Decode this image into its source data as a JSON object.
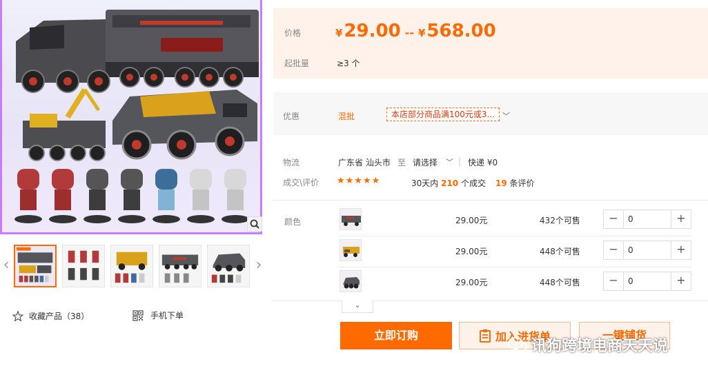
{
  "gallery": {
    "thumb_count": 5,
    "favorite_label": "收藏产品（38）",
    "mobile_order_label": "手机下单"
  },
  "price": {
    "label": "价格",
    "currency": "¥",
    "min": "29.00",
    "separator": "--",
    "max": "568.00",
    "moq_label": "起批量",
    "moq_value": "≥3 个"
  },
  "promo": {
    "label": "优惠",
    "tag": "混批",
    "coupon": "本店部分商品满100元或3..."
  },
  "logistics": {
    "label": "物流",
    "origin": "广东省 汕头市",
    "to": "至",
    "destination": "请选择",
    "shipping": "快递 ¥0"
  },
  "reviews": {
    "label": "成交\\评价",
    "rating": 4.5,
    "stars_text": "★★★★★",
    "period_prefix": "30天内",
    "deals": "210",
    "deals_suffix": "个成交",
    "review_count": "19",
    "review_suffix": "条评价"
  },
  "sku": {
    "label": "颜色",
    "rows": [
      {
        "price": "29.00元",
        "stock": "432个可售",
        "qty": "0",
        "minus": "−",
        "plus": "+"
      },
      {
        "price": "29.00元",
        "stock": "448个可售",
        "qty": "0",
        "minus": "−",
        "plus": "+"
      },
      {
        "price": "29.00元",
        "stock": "448个可售",
        "qty": "0",
        "minus": "−",
        "plus": "+"
      }
    ],
    "expand_icon": "⌄"
  },
  "actions": {
    "order_now": "立即订购",
    "add_to_list": "加入进货单",
    "one_click": "一键铺货"
  },
  "watermark": {
    "text": "讯狗跨境电商天天说"
  },
  "colors": {
    "accent": "#ff6a00",
    "price_bg": "#fff2ea",
    "promo_bg": "#f7f7f7"
  }
}
